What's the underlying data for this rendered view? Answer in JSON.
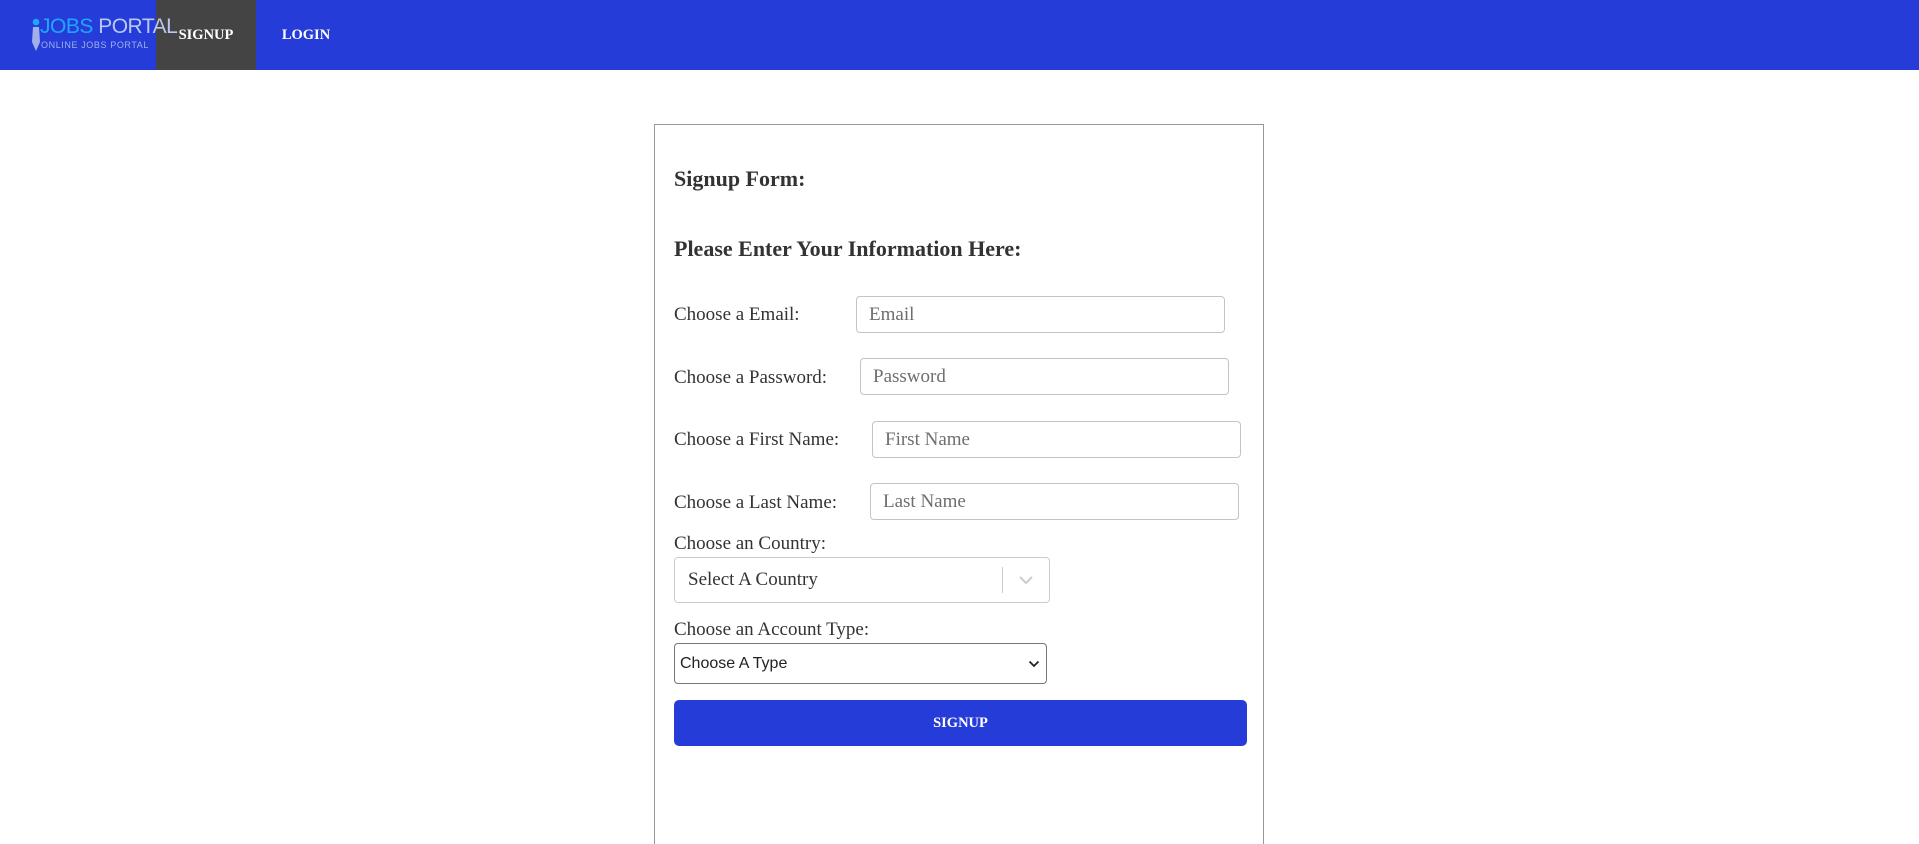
{
  "header": {
    "logo": {
      "brand_prefix": "J",
      "brand_highlight": "OBS",
      "brand_suffix": " PORTAL",
      "tagline": "ONLINE JOBS PORTAL"
    },
    "nav": {
      "signup_label": "SIGNUP",
      "login_label": "LOGIN"
    },
    "colors": {
      "bar": "#263cd9",
      "active_tab": "#444444"
    }
  },
  "form": {
    "title": "Signup Form:",
    "subtitle": "Please Enter Your Information Here:",
    "email": {
      "label": "Choose a Email:",
      "placeholder": "Email",
      "value": ""
    },
    "password": {
      "label": "Choose a Password:",
      "placeholder": "Password",
      "value": ""
    },
    "first_name": {
      "label": "Choose a First Name:",
      "placeholder": "First Name",
      "value": ""
    },
    "last_name": {
      "label": "Choose a Last Name:",
      "placeholder": "Last Name",
      "value": ""
    },
    "country": {
      "label": "Choose an Country:",
      "selected": "Select A Country",
      "icon": "chevron-down-icon"
    },
    "account_type": {
      "label": "Choose an Account Type:",
      "selected": "Choose A Type",
      "icon": "chevron-down-icon"
    },
    "submit_label": "SIGNUP"
  }
}
